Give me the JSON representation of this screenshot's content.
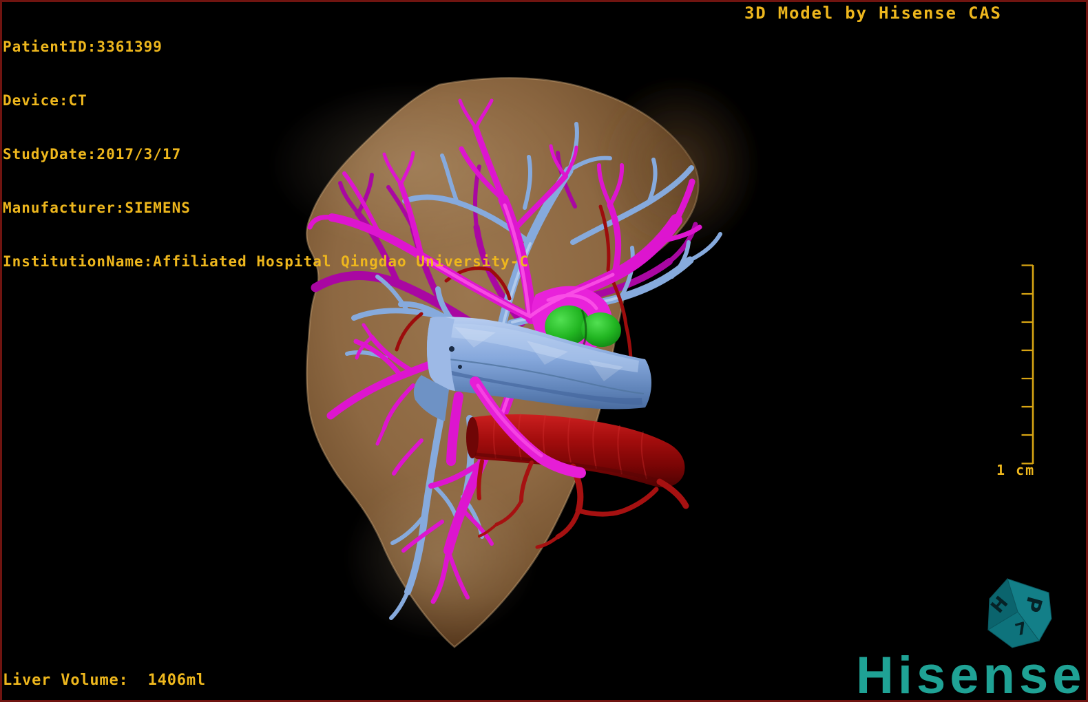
{
  "hud": {
    "patient_lines": [
      "PatientID:3361399",
      "Device:CT",
      "StudyDate:2017/3/17",
      "Manufacturer:SIEMENS",
      "InstitutionName:Affiliated Hospital Qingdao University-C"
    ],
    "watermark": "3D Model by Hisense CAS",
    "liver_volume": "Liver Volume:  1406ml"
  },
  "scale_bar": {
    "label": "1 cm",
    "tick_count": 8
  },
  "branding": {
    "logo_text": "Hisense"
  },
  "orientation_cube": {
    "faces": [
      {
        "position": "top-right",
        "letter": "P"
      },
      {
        "position": "left",
        "letter": "H"
      },
      {
        "position": "bottom",
        "letter": "7"
      }
    ]
  },
  "colors": {
    "background": "#000000",
    "frame_border": "#701410",
    "hud_gold": "#eeb71d",
    "scale_gold": "#d8a513",
    "logo_teal": "#1fa295",
    "cube_teal_light": "#137f88",
    "cube_teal_dark": "#0b646d",
    "liver_tan": "#8d6842",
    "portal_vein_magenta": "#dd15cf",
    "hepatic_vein_blue": "#86aadd",
    "vena_cava_blue": "#86a8dc",
    "hepatic_artery_red": "#a30d0d",
    "gallbladder_green": "#22b622"
  }
}
